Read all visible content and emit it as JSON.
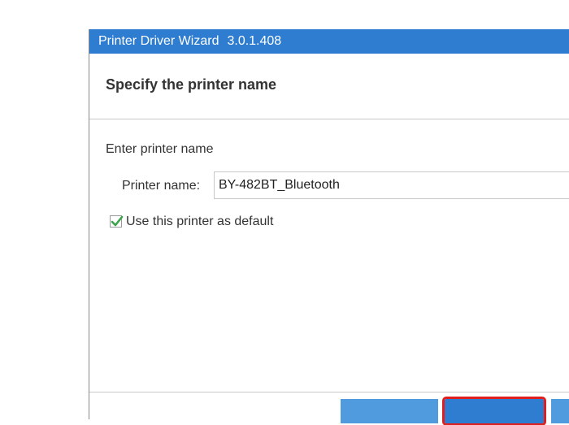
{
  "window": {
    "title": "Printer Driver Wizard",
    "version": "3.0.1.408"
  },
  "header": {
    "title": "Specify the printer name"
  },
  "form": {
    "instruction": "Enter printer name",
    "printer_name_label": "Printer name:",
    "printer_name_value": "BY-482BT_Bluetooth",
    "default_checkbox_label": "Use this printer as default",
    "default_checked": true
  },
  "colors": {
    "titlebar": "#2f7dd0",
    "highlight_border": "#e01e1e",
    "check_green": "#3aa54a"
  }
}
